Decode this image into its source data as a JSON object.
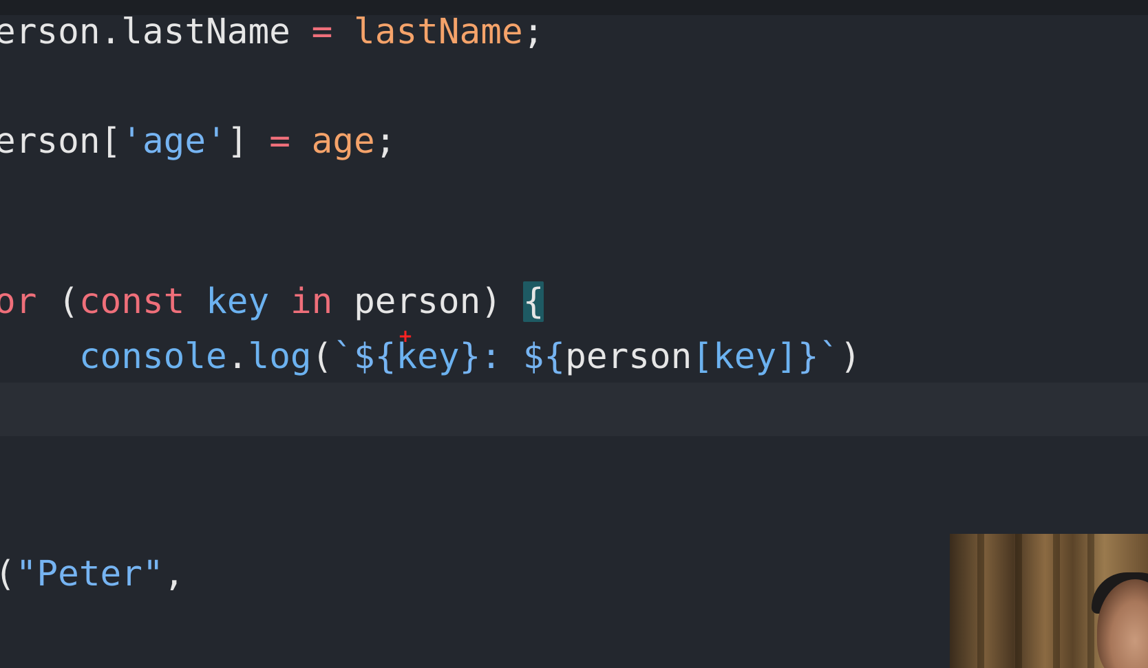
{
  "code_lines": [
    {
      "id": "line-lastname",
      "tokens": [
        {
          "text": "erson.lastName",
          "cls": "tok-ident"
        },
        {
          "text": " ",
          "cls": "tok-punc"
        },
        {
          "text": "=",
          "cls": "tok-op"
        },
        {
          "text": " ",
          "cls": "tok-punc"
        },
        {
          "text": "lastName",
          "cls": "tok-param"
        },
        {
          "text": ";",
          "cls": "tok-punc"
        }
      ]
    },
    {
      "id": "line-age",
      "tokens": [
        {
          "text": "erson[",
          "cls": "tok-ident"
        },
        {
          "text": "'age'",
          "cls": "tok-str"
        },
        {
          "text": "]",
          "cls": "tok-ident"
        },
        {
          "text": " ",
          "cls": "tok-punc"
        },
        {
          "text": "=",
          "cls": "tok-op"
        },
        {
          "text": " ",
          "cls": "tok-punc"
        },
        {
          "text": "age",
          "cls": "tok-param"
        },
        {
          "text": ";",
          "cls": "tok-punc"
        }
      ]
    },
    {
      "id": "line-for",
      "tokens": [
        {
          "text": "or",
          "cls": "tok-kw"
        },
        {
          "text": " (",
          "cls": "tok-punc"
        },
        {
          "text": "const",
          "cls": "tok-decl"
        },
        {
          "text": " ",
          "cls": "tok-punc"
        },
        {
          "text": "key",
          "cls": "tok-var"
        },
        {
          "text": " ",
          "cls": "tok-punc"
        },
        {
          "text": "in",
          "cls": "tok-kw"
        },
        {
          "text": " ",
          "cls": "tok-punc"
        },
        {
          "text": "person",
          "cls": "tok-ident"
        },
        {
          "text": ") ",
          "cls": "tok-punc"
        },
        {
          "text": "{",
          "cls": "tok-punc brace-match"
        }
      ]
    },
    {
      "id": "line-console",
      "tokens": [
        {
          "text": "    ",
          "cls": "tok-punc"
        },
        {
          "text": "console",
          "cls": "tok-method"
        },
        {
          "text": ".",
          "cls": "tok-punc"
        },
        {
          "text": "log",
          "cls": "tok-method"
        },
        {
          "text": "(",
          "cls": "tok-punc"
        },
        {
          "text": "`${",
          "cls": "tok-tpl"
        },
        {
          "text": "key",
          "cls": "tok-var"
        },
        {
          "text": "}: ${",
          "cls": "tok-tpl"
        },
        {
          "text": "person",
          "cls": "tok-ident"
        },
        {
          "text": "[key]",
          "cls": "tok-var"
        },
        {
          "text": "}`",
          "cls": "tok-tpl"
        },
        {
          "text": ")",
          "cls": "tok-punc"
        }
      ]
    },
    {
      "id": "line-peter",
      "tokens": [
        {
          "text": "(",
          "cls": "tok-punc"
        },
        {
          "text": "\"Peter\"",
          "cls": "tok-str"
        },
        {
          "text": ",",
          "cls": "tok-punc"
        }
      ]
    },
    {
      "id": "line-fragment",
      "tokens": [
        {
          "text": ",",
          "cls": "tok-punc"
        }
      ]
    }
  ],
  "colors": {
    "background": "#23272e",
    "current_line": "#2a2e35",
    "keyword": "#ef6f7a",
    "parameter": "#f5a36a",
    "variable": "#6cb2f0",
    "bracket_match": "#1e5a63",
    "cursor": "#ff2222"
  },
  "cursor_glyph": "+"
}
